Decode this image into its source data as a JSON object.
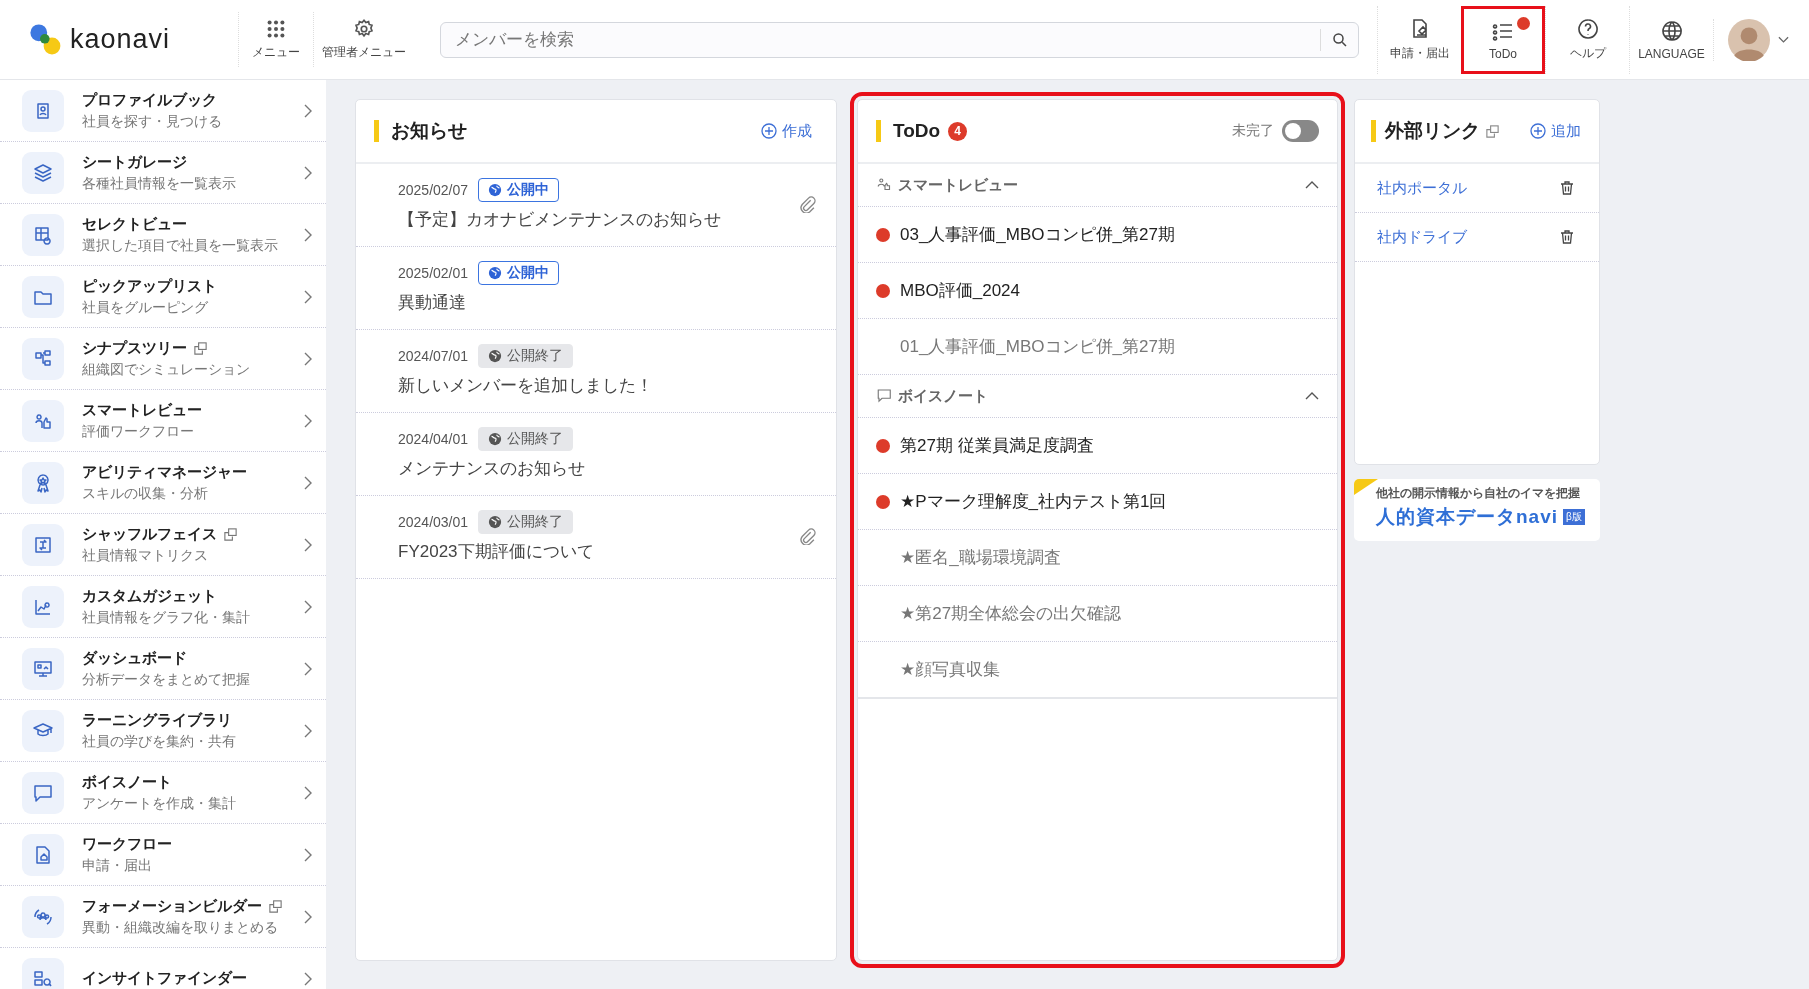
{
  "header": {
    "logo": "kaonavi",
    "nav_left": [
      {
        "label": "メニュー"
      },
      {
        "label": "管理者メニュー"
      }
    ],
    "search": {
      "placeholder": "メンバーを検索"
    },
    "nav_right": [
      {
        "label": "申請・届出",
        "badge": false,
        "highlighted": false
      },
      {
        "label": "ToDo",
        "badge": true,
        "highlighted": true
      },
      {
        "label": "ヘルプ",
        "badge": false,
        "highlighted": false
      },
      {
        "label": "LANGUAGE",
        "badge": false,
        "highlighted": false
      }
    ]
  },
  "sidebar": {
    "items": [
      {
        "title": "プロファイルブック",
        "subtitle": "社員を探す・見つける",
        "external": false
      },
      {
        "title": "シートガレージ",
        "subtitle": "各種社員情報を一覧表示",
        "external": false
      },
      {
        "title": "セレクトビュー",
        "subtitle": "選択した項目で社員を一覧表示",
        "external": false
      },
      {
        "title": "ピックアップリスト",
        "subtitle": "社員をグルーピング",
        "external": false
      },
      {
        "title": "シナプスツリー",
        "subtitle": "組織図でシミュレーション",
        "external": true
      },
      {
        "title": "スマートレビュー",
        "subtitle": "評価ワークフロー",
        "external": false
      },
      {
        "title": "アビリティマネージャー",
        "subtitle": "スキルの収集・分析",
        "external": false
      },
      {
        "title": "シャッフルフェイス",
        "subtitle": "社員情報マトリクス",
        "external": true
      },
      {
        "title": "カスタムガジェット",
        "subtitle": "社員情報をグラフ化・集計",
        "external": false
      },
      {
        "title": "ダッシュボード",
        "subtitle": "分析データをまとめて把握",
        "external": false
      },
      {
        "title": "ラーニングライブラリ",
        "subtitle": "社員の学びを集約・共有",
        "external": false
      },
      {
        "title": "ボイスノート",
        "subtitle": "アンケートを作成・集計",
        "external": false
      },
      {
        "title": "ワークフロー",
        "subtitle": "申請・届出",
        "external": false
      },
      {
        "title": "フォーメーションビルダー",
        "subtitle": "異動・組織改編を取りまとめる",
        "external": true
      },
      {
        "title": "インサイトファインダー",
        "external": false
      }
    ]
  },
  "notices": {
    "title": "お知らせ",
    "action": "作成",
    "items": [
      {
        "date": "2025/02/07",
        "status": "公開中",
        "published": true,
        "text": "【予定】カオナビメンテナンスのお知らせ",
        "attachment": true
      },
      {
        "date": "2025/02/01",
        "status": "公開中",
        "published": true,
        "text": "異動通達",
        "attachment": false
      },
      {
        "date": "2024/07/01",
        "status": "公開終了",
        "published": false,
        "text": "新しいメンバーを追加しました！",
        "attachment": false
      },
      {
        "date": "2024/04/01",
        "status": "公開終了",
        "published": false,
        "text": "メンテナンスのお知らせ",
        "attachment": false
      },
      {
        "date": "2024/03/01",
        "status": "公開終了",
        "published": false,
        "text": "FY2023下期評価について",
        "attachment": true
      }
    ]
  },
  "todo": {
    "title": "ToDo",
    "count": "4",
    "filter_label": "未完了",
    "filter_on": false,
    "highlighted": true,
    "groups": [
      {
        "title": "スマートレビュー",
        "expanded": true,
        "items": [
          {
            "text": "03_人事評価_MBOコンピ併_第27期",
            "unread": true
          },
          {
            "text": "MBO評価_2024",
            "unread": true
          },
          {
            "text": "01_人事評価_MBOコンピ併_第27期",
            "unread": false
          }
        ]
      },
      {
        "title": "ボイスノート",
        "expanded": true,
        "items": [
          {
            "text": "第27期 従業員満足度調査",
            "unread": true
          },
          {
            "text": "★Pマーク理解度_社内テスト第1回",
            "unread": true
          },
          {
            "text": "★匿名_職場環境調査",
            "unread": false
          },
          {
            "text": "★第27期全体総会の出欠確認",
            "unread": false
          },
          {
            "text": "★顔写真収集",
            "unread": false
          }
        ]
      }
    ]
  },
  "links": {
    "title": "外部リンク",
    "action": "追加",
    "items": [
      {
        "label": "社内ポータル"
      },
      {
        "label": "社内ドライブ"
      }
    ]
  },
  "banner": {
    "tagline": "他社の開示情報から自社のイマを把握",
    "name": "人的資本データnavi",
    "badge": "β版"
  }
}
